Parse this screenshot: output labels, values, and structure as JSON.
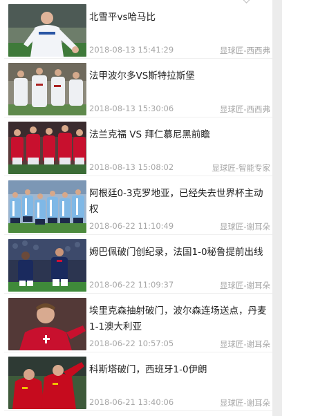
{
  "news": {
    "items": [
      {
        "title": "北雪平vs哈马比",
        "time": "2018-08-13 15:41:29",
        "source": "显球匠-西西弗",
        "thumb": "player-celebrating"
      },
      {
        "title": "法甲波尔多VS斯特拉斯堡",
        "time": "2018-08-13 15:30:06",
        "source": "显球匠-西西弗",
        "thumb": "team-walking"
      },
      {
        "title": "法兰克福 VS 拜仁慕尼黑前瞻",
        "time": "2018-08-13 15:08:02",
        "source": "显球匠-智能专家",
        "thumb": "bayern-team"
      },
      {
        "title": "阿根廷0-3克罗地亚，已经失去世界杯主动权",
        "time": "2018-06-22 11:10:49",
        "source": "显球匠-谢耳朵",
        "thumb": "team-lineup"
      },
      {
        "title": "姆巴佩破门创纪录，法国1-0秘鲁提前出线",
        "time": "2018-06-22 11:09:37",
        "source": "显球匠-谢耳朵",
        "thumb": "france-players"
      },
      {
        "title": "埃里克森抽射破门，波尔森连场送点，丹麦1-1澳大利亚",
        "time": "2018-06-22 10:57:05",
        "source": "显球匠-谢耳朵",
        "thumb": "denmark-player"
      },
      {
        "title": "科斯塔破门，西班牙1-0伊朗",
        "time": "2018-06-21 13:40:06",
        "source": "显球匠-谢耳朵",
        "thumb": "spain-players"
      }
    ]
  }
}
